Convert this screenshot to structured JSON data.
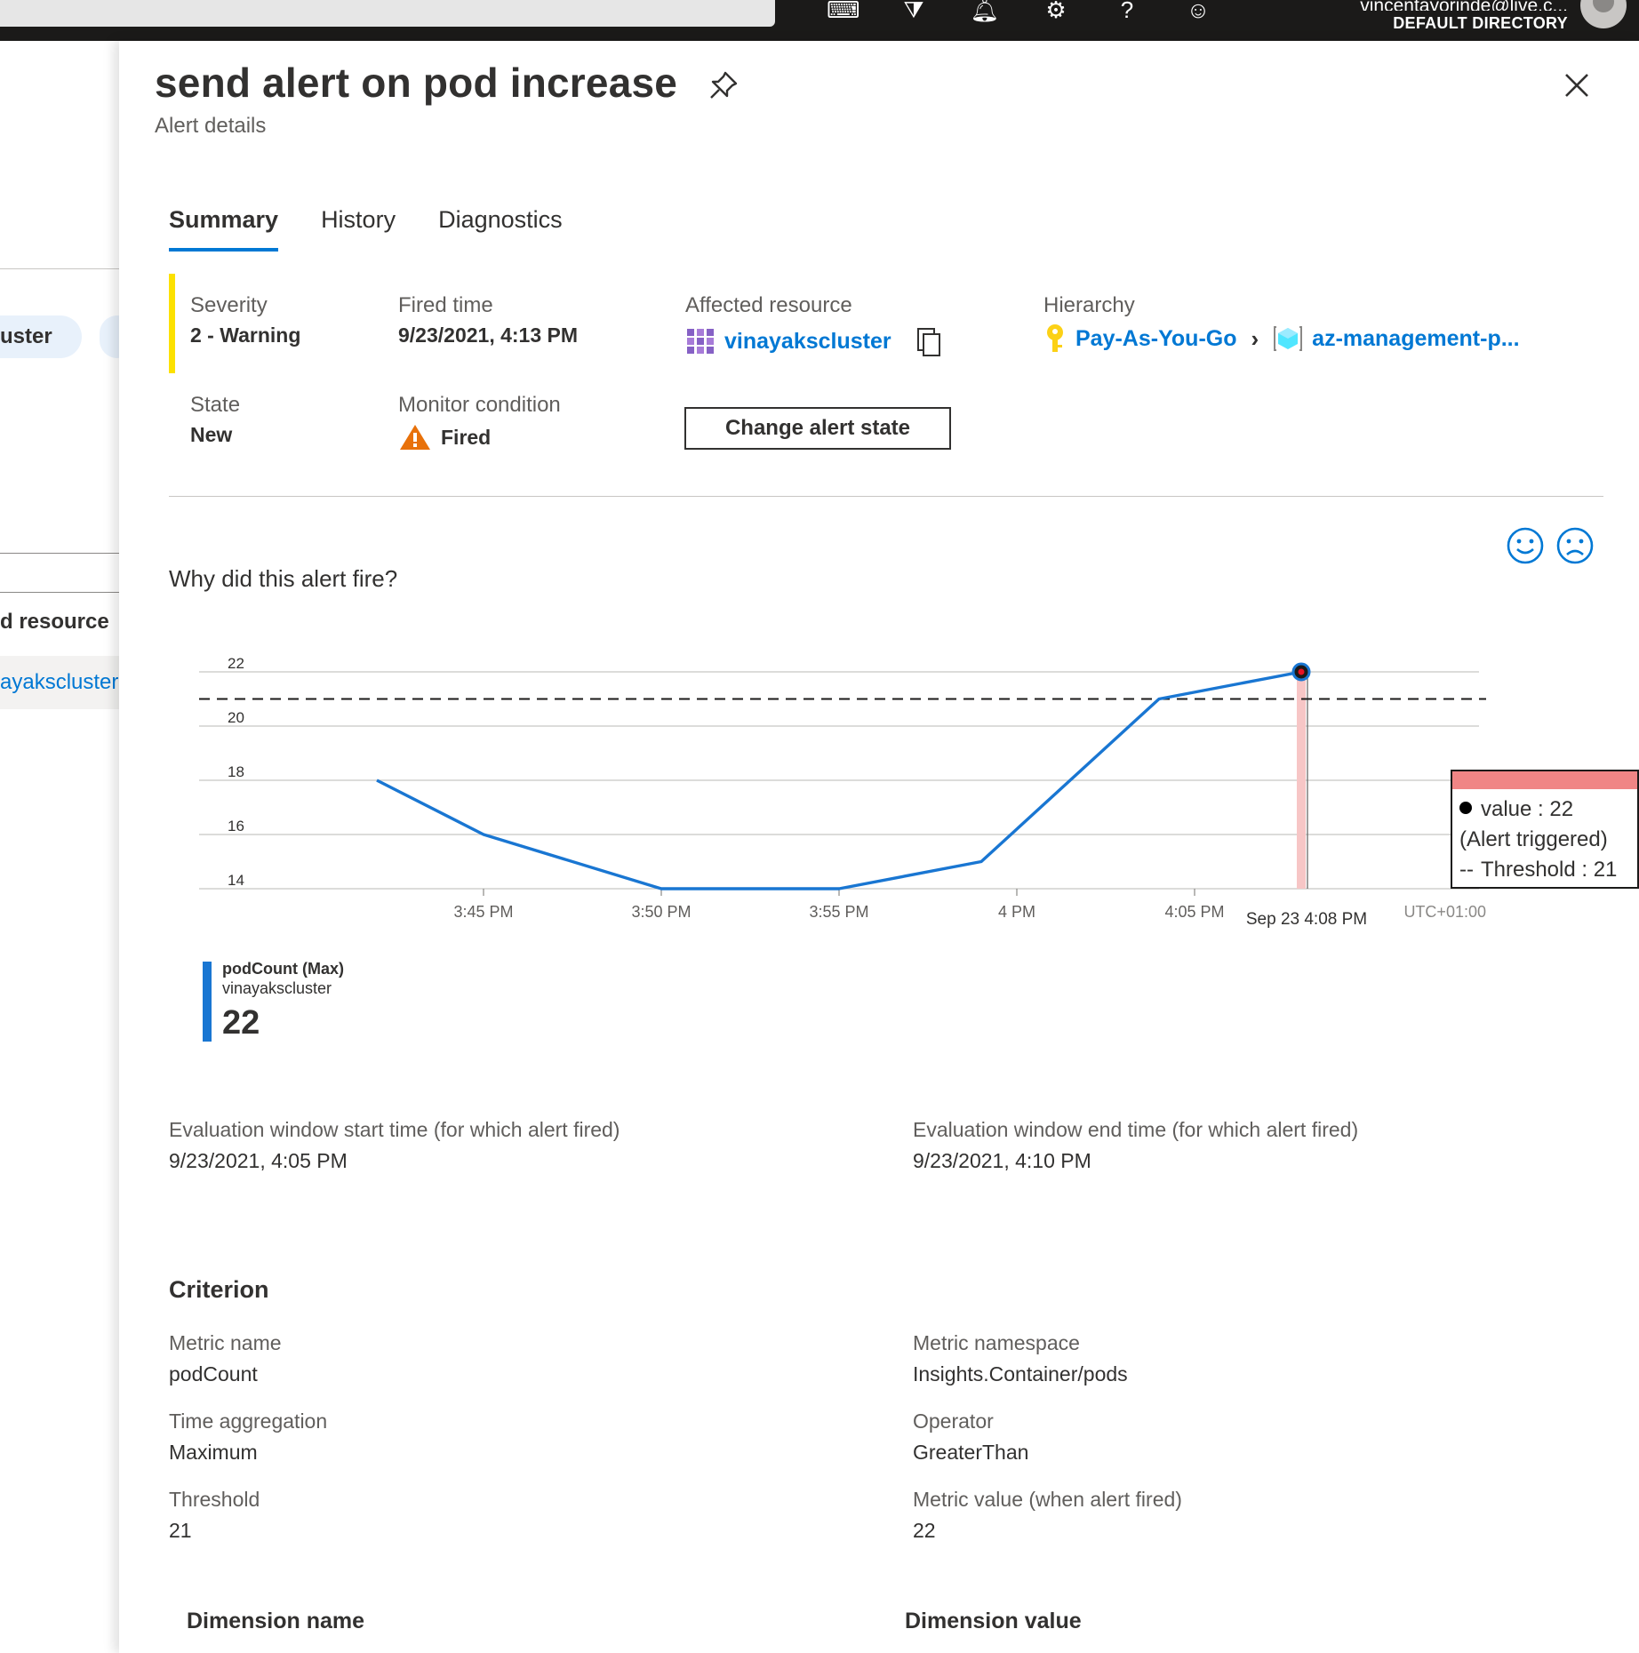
{
  "topbar": {
    "user_email": "vincentayorinde@live.c...",
    "directory": "DEFAULT DIRECTORY"
  },
  "left_pane": {
    "chip_label": "uster",
    "resource_label": "d resource",
    "resource_link": "ayakscluster"
  },
  "panel": {
    "title": "send alert on pod increase",
    "subtitle": "Alert details",
    "tabs": [
      {
        "label": "Summary",
        "active": true
      },
      {
        "label": "History",
        "active": false
      },
      {
        "label": "Diagnostics",
        "active": false
      }
    ],
    "severity": {
      "label": "Severity",
      "value": "2 - Warning",
      "color": "#fce100"
    },
    "fired_time": {
      "label": "Fired time",
      "value": "9/23/2021, 4:13 PM"
    },
    "affected_resource": {
      "label": "Affected resource",
      "value": "vinayakscluster"
    },
    "hierarchy": {
      "label": "Hierarchy",
      "items": [
        "Pay-As-You-Go",
        "az-management-p..."
      ]
    },
    "state": {
      "label": "State",
      "value": "New"
    },
    "monitor_condition": {
      "label": "Monitor condition",
      "value": "Fired"
    },
    "change_state_button": "Change alert state",
    "why_title": "Why did this alert fire?",
    "legend": {
      "metric": "podCount (Max)",
      "resource": "vinayakscluster",
      "value": "22"
    },
    "tooltip": {
      "value_line": "value : 22",
      "triggered_line": "(Alert triggered)",
      "threshold_line": "Threshold : 21"
    },
    "evaluation": {
      "start_label": "Evaluation window start time (for which alert fired)",
      "start_value": "9/23/2021, 4:05 PM",
      "end_label": "Evaluation window end time (for which alert fired)",
      "end_value": "9/23/2021, 4:10 PM"
    },
    "criterion": {
      "title": "Criterion",
      "metric_name_label": "Metric name",
      "metric_name": "podCount",
      "metric_namespace_label": "Metric namespace",
      "metric_namespace": "Insights.Container/pods",
      "time_aggregation_label": "Time aggregation",
      "time_aggregation": "Maximum",
      "operator_label": "Operator",
      "operator": "GreaterThan",
      "threshold_label": "Threshold",
      "threshold": "21",
      "metric_value_label": "Metric value (when alert fired)",
      "metric_value": "22"
    },
    "dimension_headers": {
      "name": "Dimension name",
      "value": "Dimension value"
    }
  },
  "chart_data": {
    "type": "line",
    "title": "",
    "y_ticks": [
      "22",
      "20",
      "18",
      "16",
      "14"
    ],
    "ylim": [
      14,
      22
    ],
    "x_ticks": [
      "3:45 PM",
      "3:50 PM",
      "3:55 PM",
      "4 PM",
      "4:05 PM"
    ],
    "x_highlight_label": "Sep 23 4:08 PM",
    "timezone_label": "UTC+01:00",
    "threshold": 21,
    "series": [
      {
        "name": "podCount (Max)",
        "color": "#1976d2",
        "x": [
          "3:42 PM",
          "3:45 PM",
          "3:50 PM",
          "3:55 PM",
          "3:59 PM",
          "4:04 PM",
          "4:08 PM"
        ],
        "values": [
          18,
          16,
          14,
          14,
          15,
          21,
          22
        ]
      }
    ],
    "alert_point": {
      "x": "4:08 PM",
      "value": 22
    },
    "grid": true
  }
}
